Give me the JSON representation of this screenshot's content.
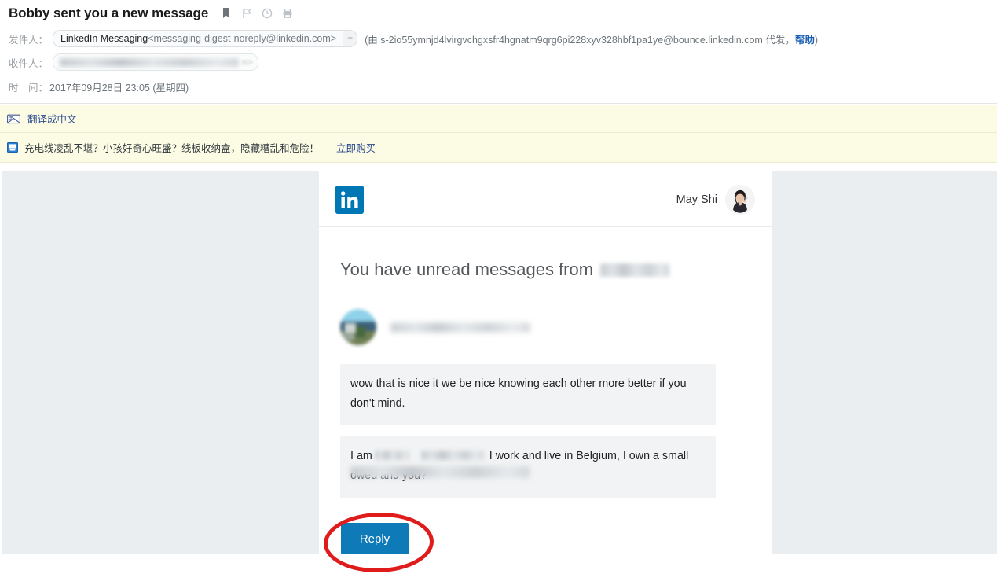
{
  "header": {
    "subject": "Bobby sent you a new message",
    "icons": [
      "bookmark-icon",
      "flag-icon",
      "clock-icon",
      "print-icon"
    ],
    "from": {
      "label": "发件人：",
      "name": "LinkedIn Messaging",
      "email": "<messaging-digest-noreply@linkedin.com>",
      "expand": "+",
      "bounce_prefix": "(由 s-2io55ymnjd4lvirgvchgxsfr4hgnatm9qrg6pi228xyv328hbf1pa1ye@bounce.linkedin.com 代发，",
      "bounce_help": "帮助",
      "bounce_suffix": ")"
    },
    "to": {
      "label": "收件人：",
      "value": "",
      "tail": "n>"
    },
    "date": {
      "label": "时　间：",
      "value": "2017年09月28日 23:05 (星期四)"
    }
  },
  "notices": {
    "translate": {
      "icon": "translate-icon",
      "link": "翻译成中文"
    },
    "ad": {
      "icon": "advertisement-icon",
      "text": "充电线凌乱不堪？小孩好奇心旺盛？线板收纳盒，隐藏糟乱和危险！",
      "cta": "立即购买"
    }
  },
  "mail": {
    "brand": "linkedin-logo",
    "user_name": "May Shi",
    "user_avatar": "woman-photo-avatar",
    "headline": "You have unread messages from",
    "headline_redacted": "",
    "sender": {
      "avatar": "blurred-profile-photo",
      "name_redacted": ""
    },
    "messages": [
      {
        "text": "wow that is nice it we be nice knowing each other more better if you don't mind."
      },
      {
        "prefix": "I am",
        "redacted_1": "",
        "redacted_2": "",
        "middle": "I work and live in Belgium, I own a small",
        "line2_redacted": "construction company, am wid",
        "line2_visible": "owed and you?"
      }
    ],
    "reply_label": "Reply"
  },
  "annotation": {
    "shape": "red-ellipse-highlight",
    "color": "#e01b1b",
    "target": "reply-button"
  },
  "colors": {
    "linkedin_blue": "#0077b5",
    "reply_blue": "#0f7ab8",
    "notice_bg": "#fcfce4",
    "body_bg": "#eaeef0",
    "link": "#2a4b8d"
  }
}
